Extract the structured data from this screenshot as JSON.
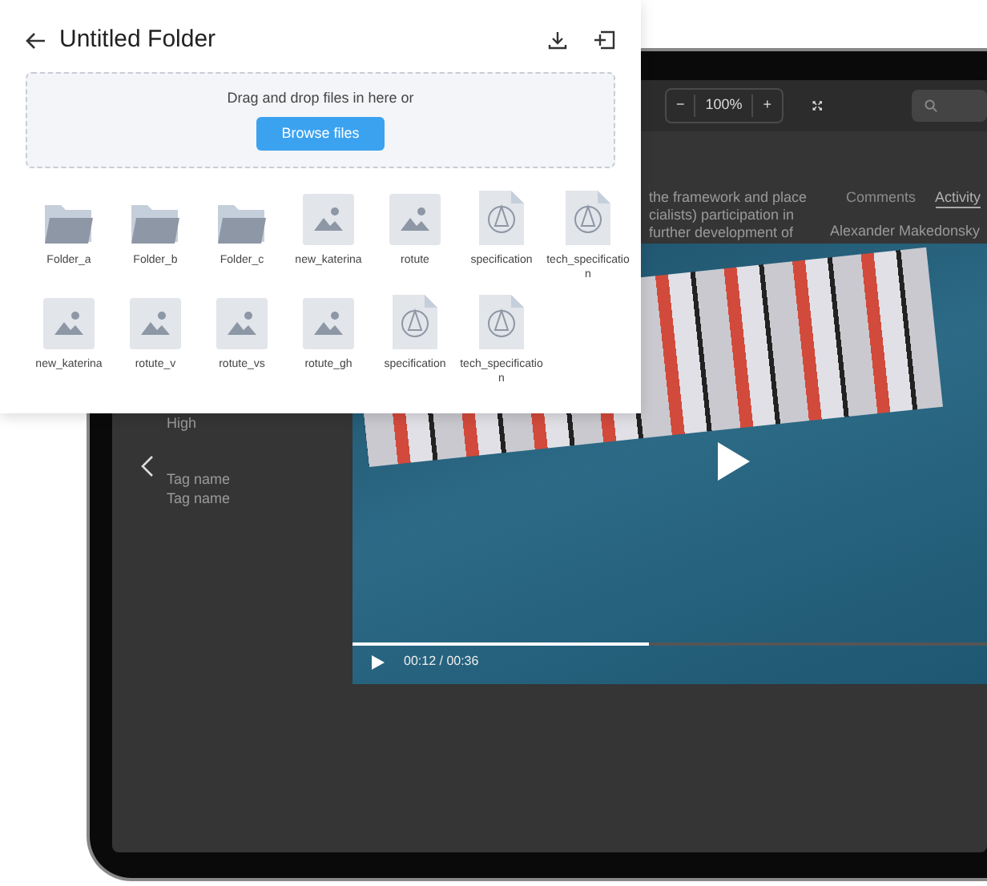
{
  "panel": {
    "title": "Untitled Folder",
    "dropzone": {
      "text": "Drag and drop files in here or",
      "button": "Browse files"
    },
    "files": [
      {
        "kind": "folder",
        "name": "Folder_a"
      },
      {
        "kind": "folder",
        "name": "Folder_b"
      },
      {
        "kind": "folder",
        "name": "Folder_c"
      },
      {
        "kind": "image",
        "name": "new_katerina"
      },
      {
        "kind": "image",
        "name": "rotute"
      },
      {
        "kind": "document",
        "name": "specification"
      },
      {
        "kind": "document",
        "name": "tech_specification"
      },
      {
        "kind": "image",
        "name": "new_katerina"
      },
      {
        "kind": "image",
        "name": "rotute_v"
      },
      {
        "kind": "image",
        "name": "rotute_vs"
      },
      {
        "kind": "image",
        "name": "rotute_gh"
      },
      {
        "kind": "document",
        "name": "specification"
      },
      {
        "kind": "document",
        "name": "tech_specification"
      }
    ]
  },
  "background_app": {
    "zoom_out": "−",
    "zoom": "100%",
    "zoom_in": "+",
    "text_lines": [
      "the framework and place",
      "cialists) participation in",
      "further development of"
    ],
    "tabs": [
      {
        "label": "Comments",
        "selected": false
      },
      {
        "label": "Activity",
        "selected": true
      }
    ],
    "activity_line": "Alexander Makedonsky",
    "priority": "High",
    "tags": [
      "Tag name",
      "Tag name"
    ],
    "video": {
      "time": "00:12 / 00:36",
      "level": 0.44
    }
  }
}
